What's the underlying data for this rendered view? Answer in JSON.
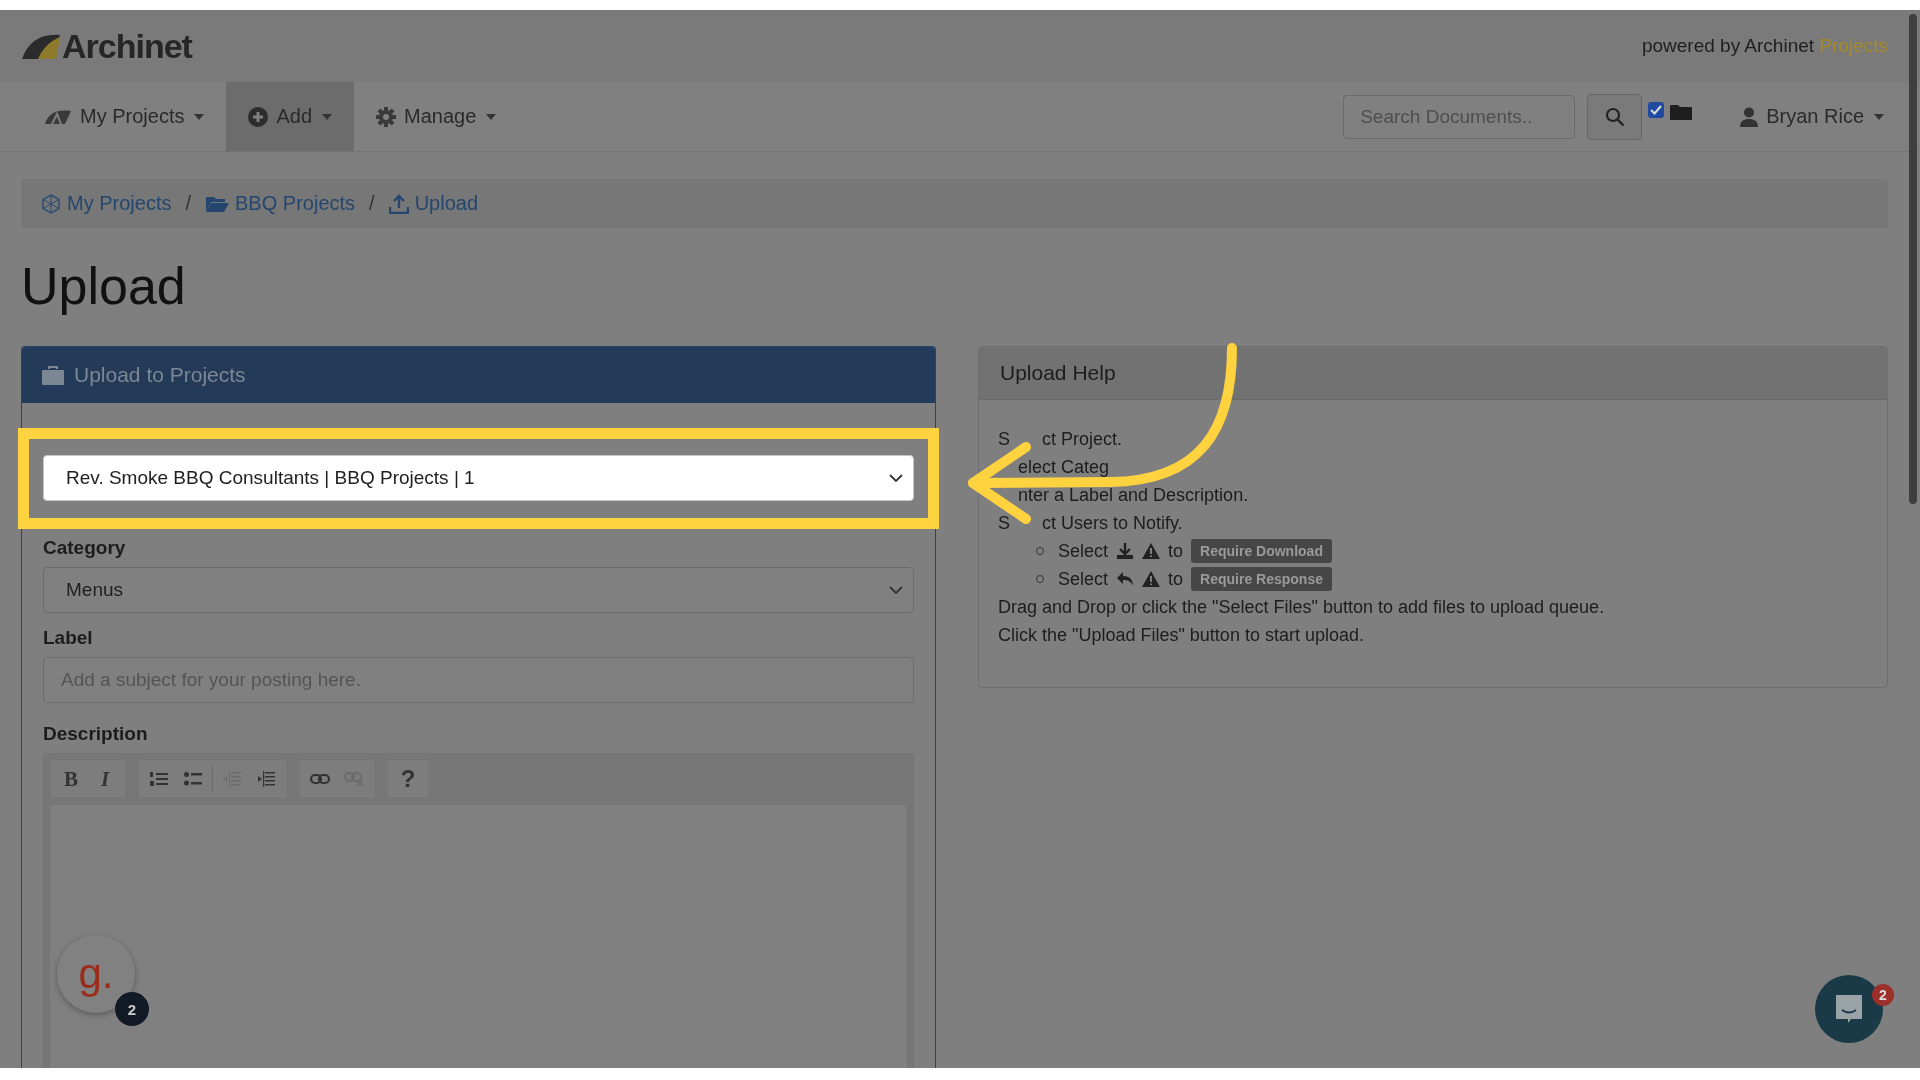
{
  "header": {
    "logo": "Archinet",
    "powered_by": "powered by Archinet",
    "powered_by_link": "Projects"
  },
  "nav": {
    "items": [
      {
        "label": "My Projects",
        "kind": "projects",
        "selected": false
      },
      {
        "label": "Add",
        "kind": "add",
        "selected": true
      },
      {
        "label": "Manage",
        "kind": "manage",
        "selected": false
      }
    ],
    "search": {
      "placeholder": "Search Documents.."
    },
    "search_folders": {
      "checked": true
    },
    "user": "Bryan Rice"
  },
  "breadcrumb": {
    "items": [
      {
        "label": "My Projects",
        "kind": "projects"
      },
      {
        "label": "BBQ Projects",
        "kind": "folder"
      },
      {
        "label": "Upload",
        "kind": "upload"
      }
    ],
    "separators": [
      "/",
      "/"
    ]
  },
  "page_title": "Upload",
  "upload_panel": {
    "title": "Upload to Projects",
    "project": {
      "value": "Rev. Smoke BBQ Consultants | BBQ Projects | 1",
      "highlighted": true
    },
    "category": {
      "label": "Category",
      "value": "Menus"
    },
    "label_field": {
      "label": "Label",
      "placeholder": "Add a subject for your posting here."
    },
    "description": {
      "label": "Description",
      "toolbar": [
        [
          {
            "kind": "bold",
            "label": "B",
            "disabled": false
          },
          {
            "kind": "italic",
            "label": "I",
            "disabled": false
          }
        ],
        [
          {
            "kind": "ordered-list",
            "disabled": false
          },
          {
            "kind": "bullet-list",
            "disabled": false
          },
          {
            "kind": "outdent",
            "disabled": true
          },
          {
            "kind": "indent",
            "disabled": false
          }
        ],
        [
          {
            "kind": "link",
            "disabled": false
          },
          {
            "kind": "unlink",
            "disabled": true
          }
        ],
        [
          {
            "kind": "help",
            "label": "?",
            "disabled": false
          }
        ]
      ]
    }
  },
  "help_panel": {
    "title": "Upload Help",
    "lines": [
      {
        "kind": "split",
        "parts": [
          "S",
          "ct Project."
        ]
      },
      {
        "kind": "clipped-start",
        "text": "elect Categ"
      },
      {
        "kind": "clipped-start",
        "text": "nter a Label and Description."
      },
      {
        "kind": "split",
        "parts": [
          "S",
          "ct Users to Notify."
        ]
      },
      {
        "kind": "download-rule",
        "select": "Select",
        "to": "to",
        "badge": "Require Download"
      },
      {
        "kind": "response-rule",
        "select": "Select",
        "to": "to",
        "badge": "Require Response"
      },
      {
        "kind": "text",
        "text": "Drag and Drop or click the \"Select Files\" button to add files to upload queue."
      },
      {
        "kind": "text",
        "text": "Click the \"Upload Files\" button to start upload."
      }
    ]
  },
  "widgets": {
    "assistant_logo": "g.",
    "assistant_badge": "2",
    "chat_badge": "2"
  }
}
